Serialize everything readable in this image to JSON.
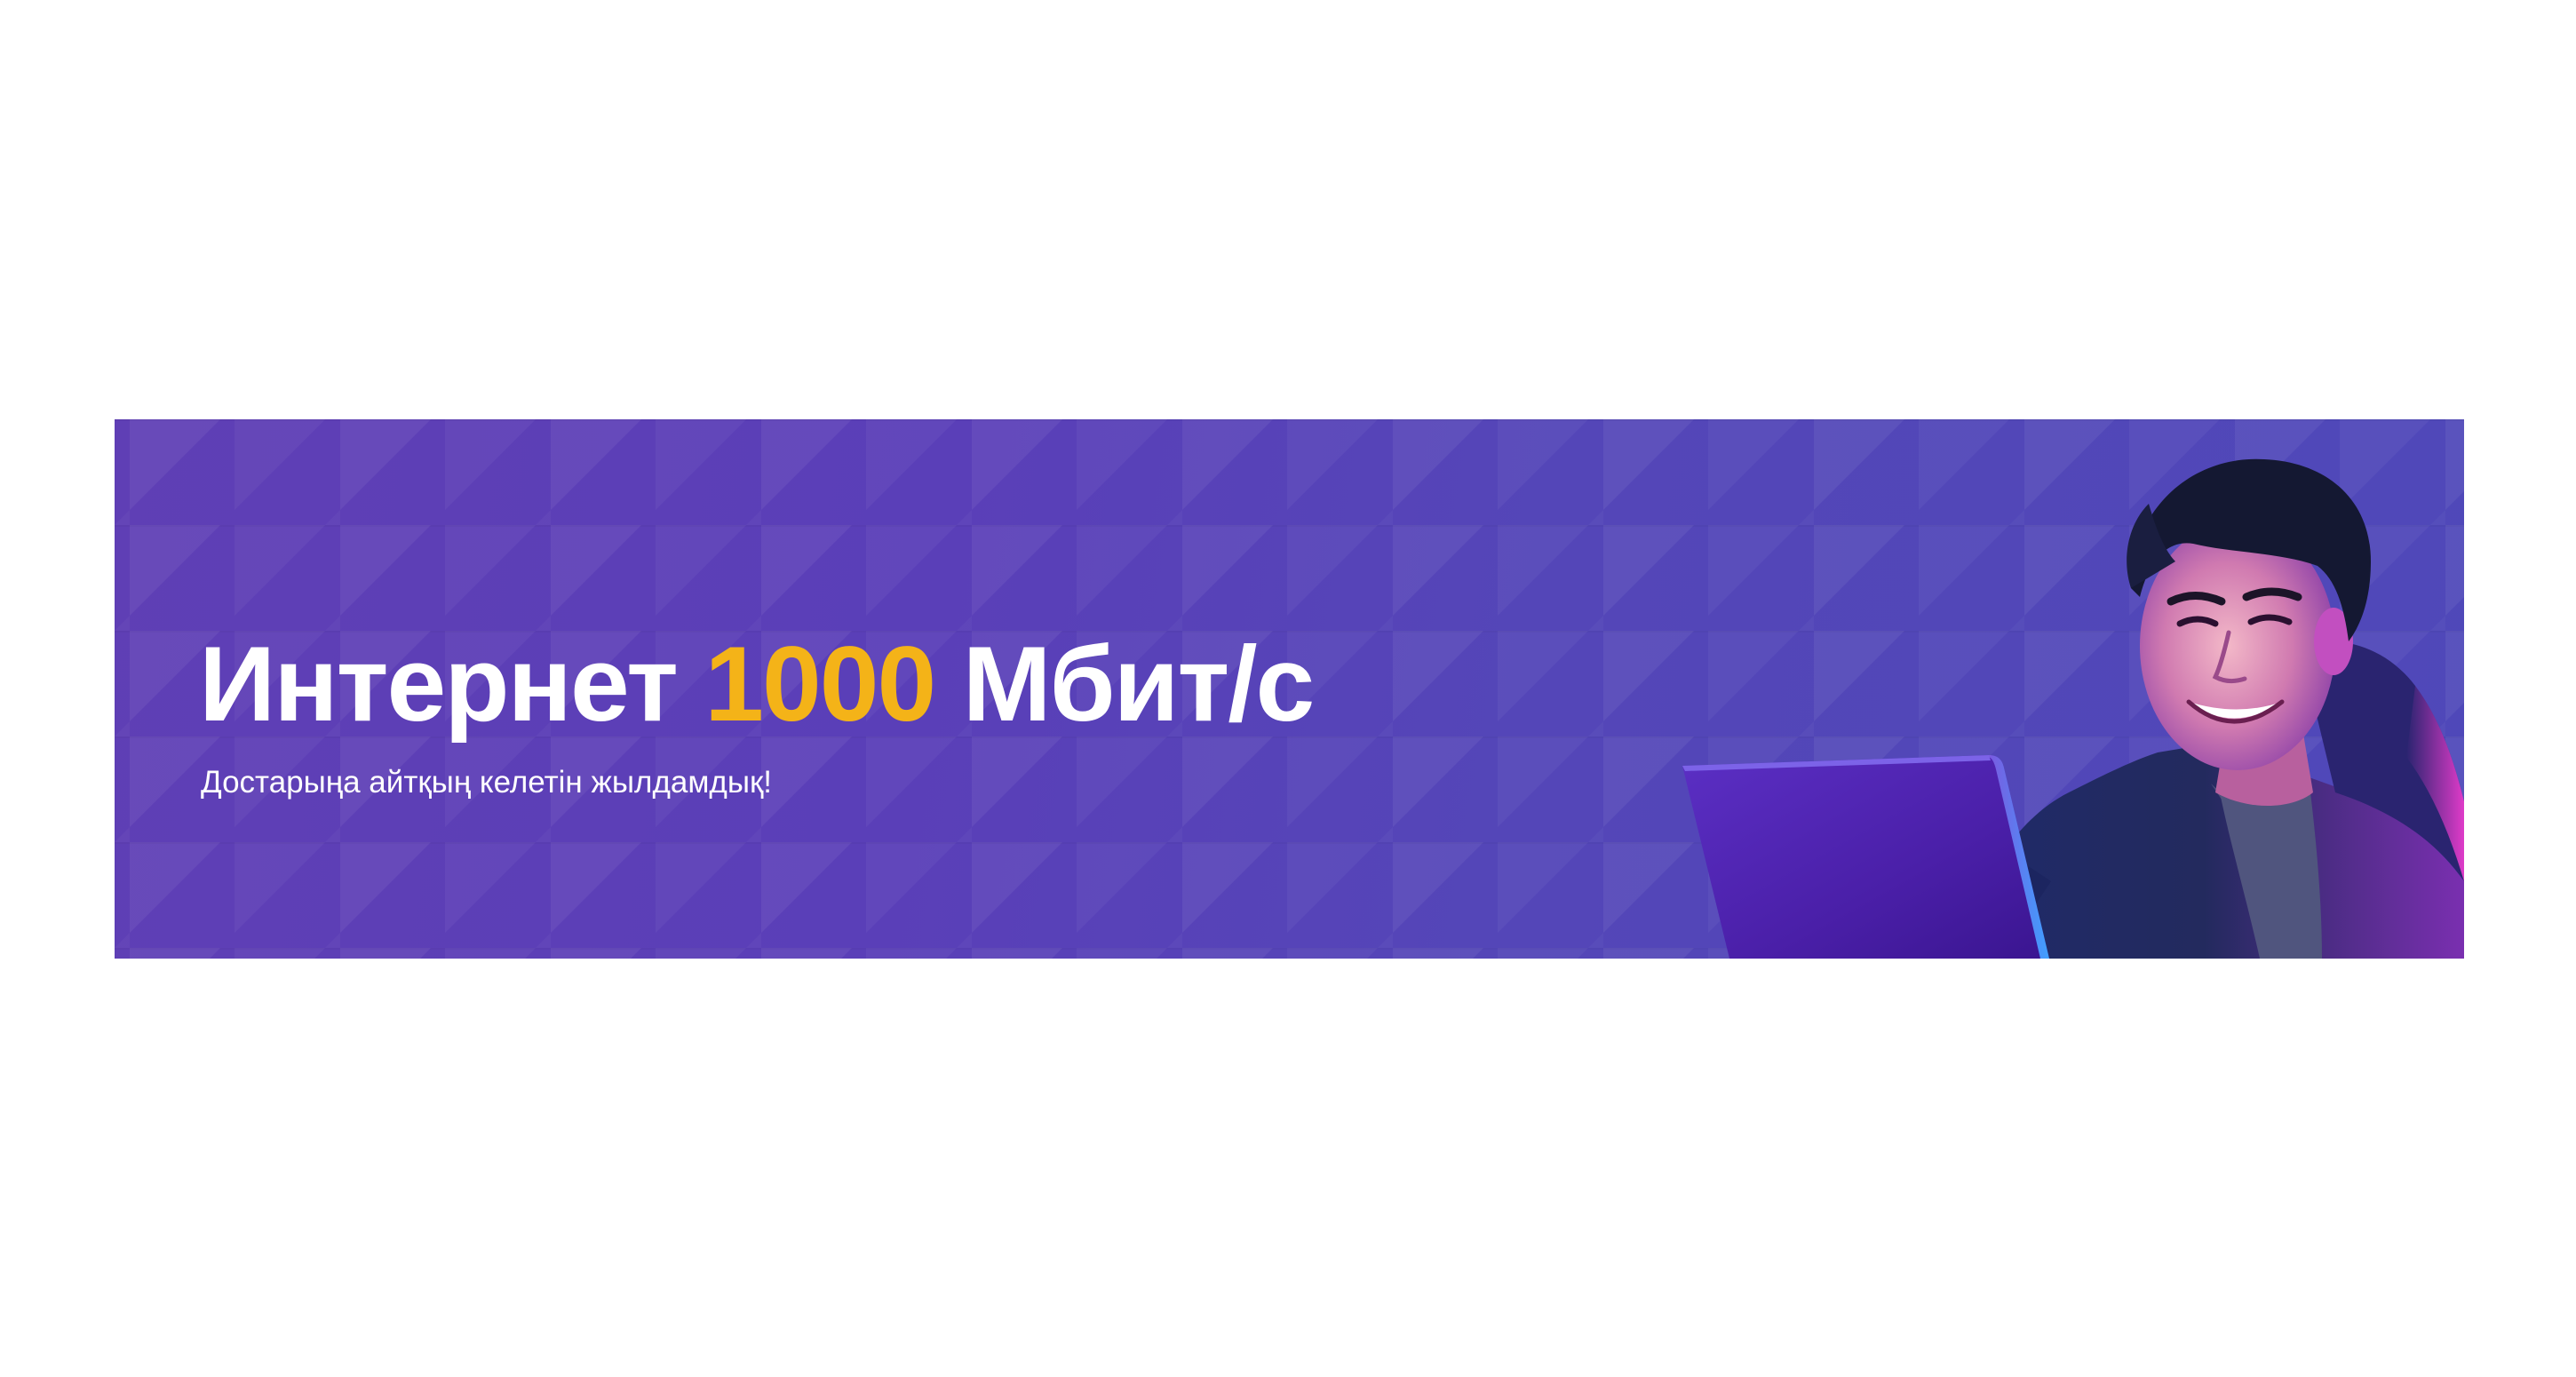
{
  "banner": {
    "headline": {
      "part1": "Интернет ",
      "speed": "1000",
      "part2": " Мбит/с"
    },
    "subtitle": "Достарыңа айтқың келетін жылдамдық!",
    "colors": {
      "background": "#5a3fb8",
      "accent": "#f4b318",
      "text": "#ffffff"
    },
    "image": "young-man-smiling-at-laptop-photo"
  }
}
